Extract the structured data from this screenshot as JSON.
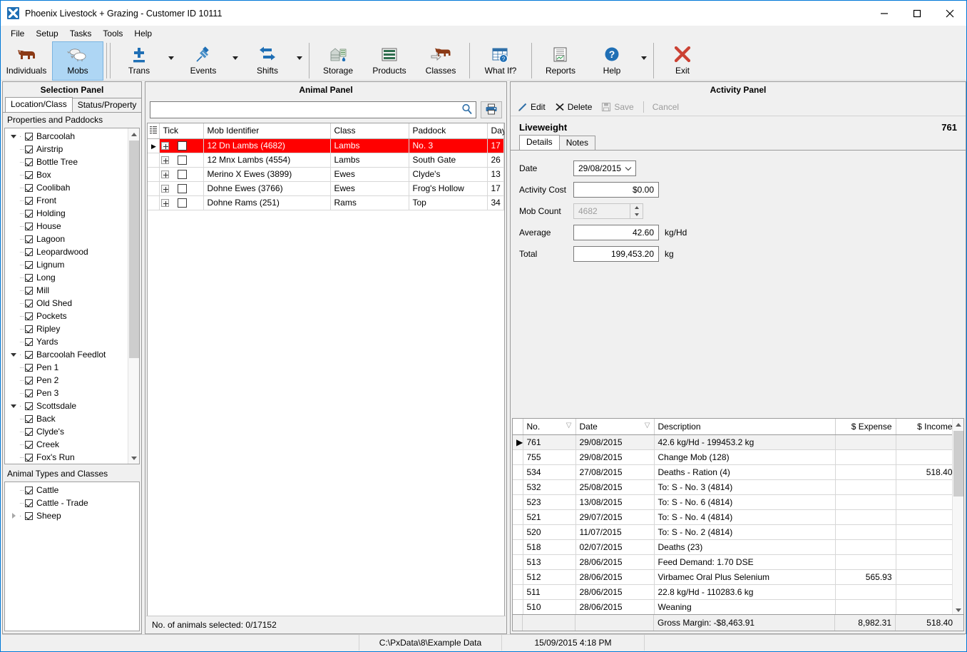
{
  "window": {
    "title": "Phoenix Livestock + Grazing - Customer ID 10111",
    "minimize": "–",
    "maximize": "□",
    "close": "×"
  },
  "menu": {
    "items": [
      "File",
      "Setup",
      "Tasks",
      "Tools",
      "Help"
    ]
  },
  "toolbar": {
    "items": [
      {
        "label": "Individuals",
        "icon": "cow-brown-icon",
        "active": false,
        "dropdown": false
      },
      {
        "label": "Mobs",
        "icon": "sheep-flock-icon",
        "active": true,
        "dropdown": false
      },
      {
        "label": "Trans",
        "icon": "plus-minus-icon",
        "active": false,
        "dropdown": true
      },
      {
        "label": "Events",
        "icon": "syringe-icon",
        "active": false,
        "dropdown": true
      },
      {
        "label": "Shifts",
        "icon": "two-way-arrows-icon",
        "active": false,
        "dropdown": true
      },
      {
        "label": "Storage",
        "icon": "silo-icon",
        "active": false,
        "dropdown": false
      },
      {
        "label": "Products",
        "icon": "shelf-icon",
        "active": false,
        "dropdown": false
      },
      {
        "label": "Classes",
        "icon": "cow-classes-icon",
        "active": false,
        "dropdown": false
      },
      {
        "label": "What If?",
        "icon": "table-question-icon",
        "active": false,
        "dropdown": false
      },
      {
        "label": "Reports",
        "icon": "report-chart-icon",
        "active": false,
        "dropdown": false
      },
      {
        "label": "Help",
        "icon": "question-circle-icon",
        "active": false,
        "dropdown": true
      },
      {
        "label": "Exit",
        "icon": "red-x-icon",
        "active": false,
        "dropdown": false
      }
    ]
  },
  "selection_panel": {
    "title": "Selection Panel",
    "tabs": [
      {
        "label": "Location/Class",
        "selected": true
      },
      {
        "label": "Status/Property",
        "selected": false
      }
    ],
    "properties_header": "Properties and Paddocks",
    "tree": [
      {
        "label": "Barcoolah",
        "level": 0,
        "checked": true,
        "expander": "down"
      },
      {
        "label": "Airstrip",
        "level": 1,
        "checked": true,
        "expander": "none"
      },
      {
        "label": "Bottle Tree",
        "level": 1,
        "checked": true,
        "expander": "none"
      },
      {
        "label": "Box",
        "level": 1,
        "checked": true,
        "expander": "none"
      },
      {
        "label": "Coolibah",
        "level": 1,
        "checked": true,
        "expander": "none"
      },
      {
        "label": "Front",
        "level": 1,
        "checked": true,
        "expander": "none"
      },
      {
        "label": "Holding",
        "level": 1,
        "checked": true,
        "expander": "none"
      },
      {
        "label": "House",
        "level": 1,
        "checked": true,
        "expander": "none"
      },
      {
        "label": "Lagoon",
        "level": 1,
        "checked": true,
        "expander": "none"
      },
      {
        "label": "Leopardwood",
        "level": 1,
        "checked": true,
        "expander": "none"
      },
      {
        "label": "Lignum",
        "level": 1,
        "checked": true,
        "expander": "none"
      },
      {
        "label": "Long",
        "level": 1,
        "checked": true,
        "expander": "none"
      },
      {
        "label": "Mill",
        "level": 1,
        "checked": true,
        "expander": "none"
      },
      {
        "label": "Old Shed",
        "level": 1,
        "checked": true,
        "expander": "none"
      },
      {
        "label": "Pockets",
        "level": 1,
        "checked": true,
        "expander": "none"
      },
      {
        "label": "Ripley",
        "level": 1,
        "checked": true,
        "expander": "none"
      },
      {
        "label": "Yards",
        "level": 1,
        "checked": true,
        "expander": "none"
      },
      {
        "label": "Barcoolah Feedlot",
        "level": 0,
        "checked": true,
        "expander": "down"
      },
      {
        "label": "Pen 1",
        "level": 1,
        "checked": true,
        "expander": "none"
      },
      {
        "label": "Pen 2",
        "level": 1,
        "checked": true,
        "expander": "none"
      },
      {
        "label": "Pen 3",
        "level": 1,
        "checked": true,
        "expander": "none"
      },
      {
        "label": "Scottsdale",
        "level": 0,
        "checked": true,
        "expander": "down"
      },
      {
        "label": "Back",
        "level": 1,
        "checked": true,
        "expander": "none"
      },
      {
        "label": "Clyde's",
        "level": 1,
        "checked": true,
        "expander": "none"
      },
      {
        "label": "Creek",
        "level": 1,
        "checked": true,
        "expander": "none"
      },
      {
        "label": "Fox's Run",
        "level": 1,
        "checked": true,
        "expander": "none"
      }
    ],
    "classes_header": "Animal Types and Classes",
    "classes_tree": [
      {
        "label": "Cattle",
        "level": 1,
        "checked": true,
        "expander": "none"
      },
      {
        "label": "Cattle - Trade",
        "level": 1,
        "checked": true,
        "expander": "none"
      },
      {
        "label": "Sheep",
        "level": 0,
        "checked": true,
        "expander": "right"
      }
    ]
  },
  "animal_panel": {
    "title": "Animal Panel",
    "search": {
      "value": "",
      "placeholder": ""
    },
    "search_icon": "magnifier-icon",
    "print_icon": "printer-icon",
    "columns": [
      "Tick",
      "Mob Identifier",
      "Class",
      "Paddock",
      "Days"
    ],
    "rows": [
      {
        "mob": "12 Dn Lambs (4682)",
        "class": "Lambs",
        "paddock": "No. 3",
        "days": "17",
        "selected": true,
        "ticked": false
      },
      {
        "mob": "12 Mnx Lambs (4554)",
        "class": "Lambs",
        "paddock": "South Gate",
        "days": "26",
        "selected": false,
        "ticked": false
      },
      {
        "mob": "Merino X Ewes (3899)",
        "class": "Ewes",
        "paddock": "Clyde's",
        "days": "13",
        "selected": false,
        "ticked": false
      },
      {
        "mob": "Dohne Ewes (3766)",
        "class": "Ewes",
        "paddock": "Frog's Hollow",
        "days": "17",
        "selected": false,
        "ticked": false
      },
      {
        "mob": "Dohne Rams (251)",
        "class": "Rams",
        "paddock": "Top",
        "days": "34",
        "selected": false,
        "ticked": false
      }
    ],
    "footer": "No. of animals selected:  0/17152"
  },
  "activity_panel": {
    "title": "Activity Panel",
    "actions": [
      {
        "label": "Edit",
        "icon": "pencil-icon",
        "enabled": true
      },
      {
        "label": "Delete",
        "icon": "x-icon",
        "enabled": true
      },
      {
        "label": "Save",
        "icon": "floppy-icon",
        "enabled": false
      },
      {
        "label": "Cancel",
        "icon": "none",
        "enabled": false
      }
    ],
    "record_title": "Liveweight",
    "record_number": "761",
    "tabs": [
      {
        "label": "Details",
        "selected": true
      },
      {
        "label": "Notes",
        "selected": false
      }
    ],
    "fields": {
      "date_label": "Date",
      "date_value": "29/08/2015",
      "cost_label": "Activity Cost",
      "cost_value": "$0.00",
      "mobcount_label": "Mob Count",
      "mobcount_value": "4682",
      "average_label": "Average",
      "average_value": "42.60",
      "average_unit": "kg/Hd",
      "total_label": "Total",
      "total_value": "199,453.20",
      "total_unit": "kg"
    },
    "history": {
      "columns": [
        "No.",
        "Date",
        "Description",
        "$ Expense",
        "$ Income"
      ],
      "rows": [
        {
          "no": "761",
          "date": "29/08/2015",
          "desc": "42.6 kg/Hd - 199453.2 kg",
          "expense": "",
          "income": "",
          "current": true
        },
        {
          "no": "755",
          "date": "29/08/2015",
          "desc": "Change Mob (128)",
          "expense": "",
          "income": "",
          "current": false
        },
        {
          "no": "534",
          "date": "27/08/2015",
          "desc": "Deaths - Ration (4)",
          "expense": "",
          "income": "518.40",
          "current": false
        },
        {
          "no": "532",
          "date": "25/08/2015",
          "desc": "To: S - No. 3 (4814)",
          "expense": "",
          "income": "",
          "current": false
        },
        {
          "no": "523",
          "date": "13/08/2015",
          "desc": "To: S - No. 6 (4814)",
          "expense": "",
          "income": "",
          "current": false
        },
        {
          "no": "521",
          "date": "29/07/2015",
          "desc": "To: S - No. 4 (4814)",
          "expense": "",
          "income": "",
          "current": false
        },
        {
          "no": "520",
          "date": "11/07/2015",
          "desc": "To: S - No. 2 (4814)",
          "expense": "",
          "income": "",
          "current": false
        },
        {
          "no": "518",
          "date": "02/07/2015",
          "desc": "Deaths (23)",
          "expense": "",
          "income": "",
          "current": false
        },
        {
          "no": "513",
          "date": "28/06/2015",
          "desc": "Feed Demand: 1.70 DSE",
          "expense": "",
          "income": "",
          "current": false
        },
        {
          "no": "512",
          "date": "28/06/2015",
          "desc": "Virbamec Oral Plus Selenium",
          "expense": "565.93",
          "income": "",
          "current": false
        },
        {
          "no": "511",
          "date": "28/06/2015",
          "desc": "22.8 kg/Hd - 110283.6 kg",
          "expense": "",
          "income": "",
          "current": false
        },
        {
          "no": "510",
          "date": "28/06/2015",
          "desc": "Weaning",
          "expense": "",
          "income": "",
          "current": false
        }
      ],
      "footer": {
        "label": "Gross Margin: -$8,463.91",
        "expense_total": "8,982.31",
        "income_total": "518.40"
      }
    }
  },
  "statusbar": {
    "path": "C:\\PxData\\8\\Example Data",
    "datetime": "15/09/2015  4:18 PM"
  },
  "colors": {
    "accent": "#0078d7",
    "selection_red": "#ff0000",
    "toolbar_active": "#aed6f4",
    "icon_blue": "#1f6fb5",
    "exit_red": "#cb4133"
  }
}
